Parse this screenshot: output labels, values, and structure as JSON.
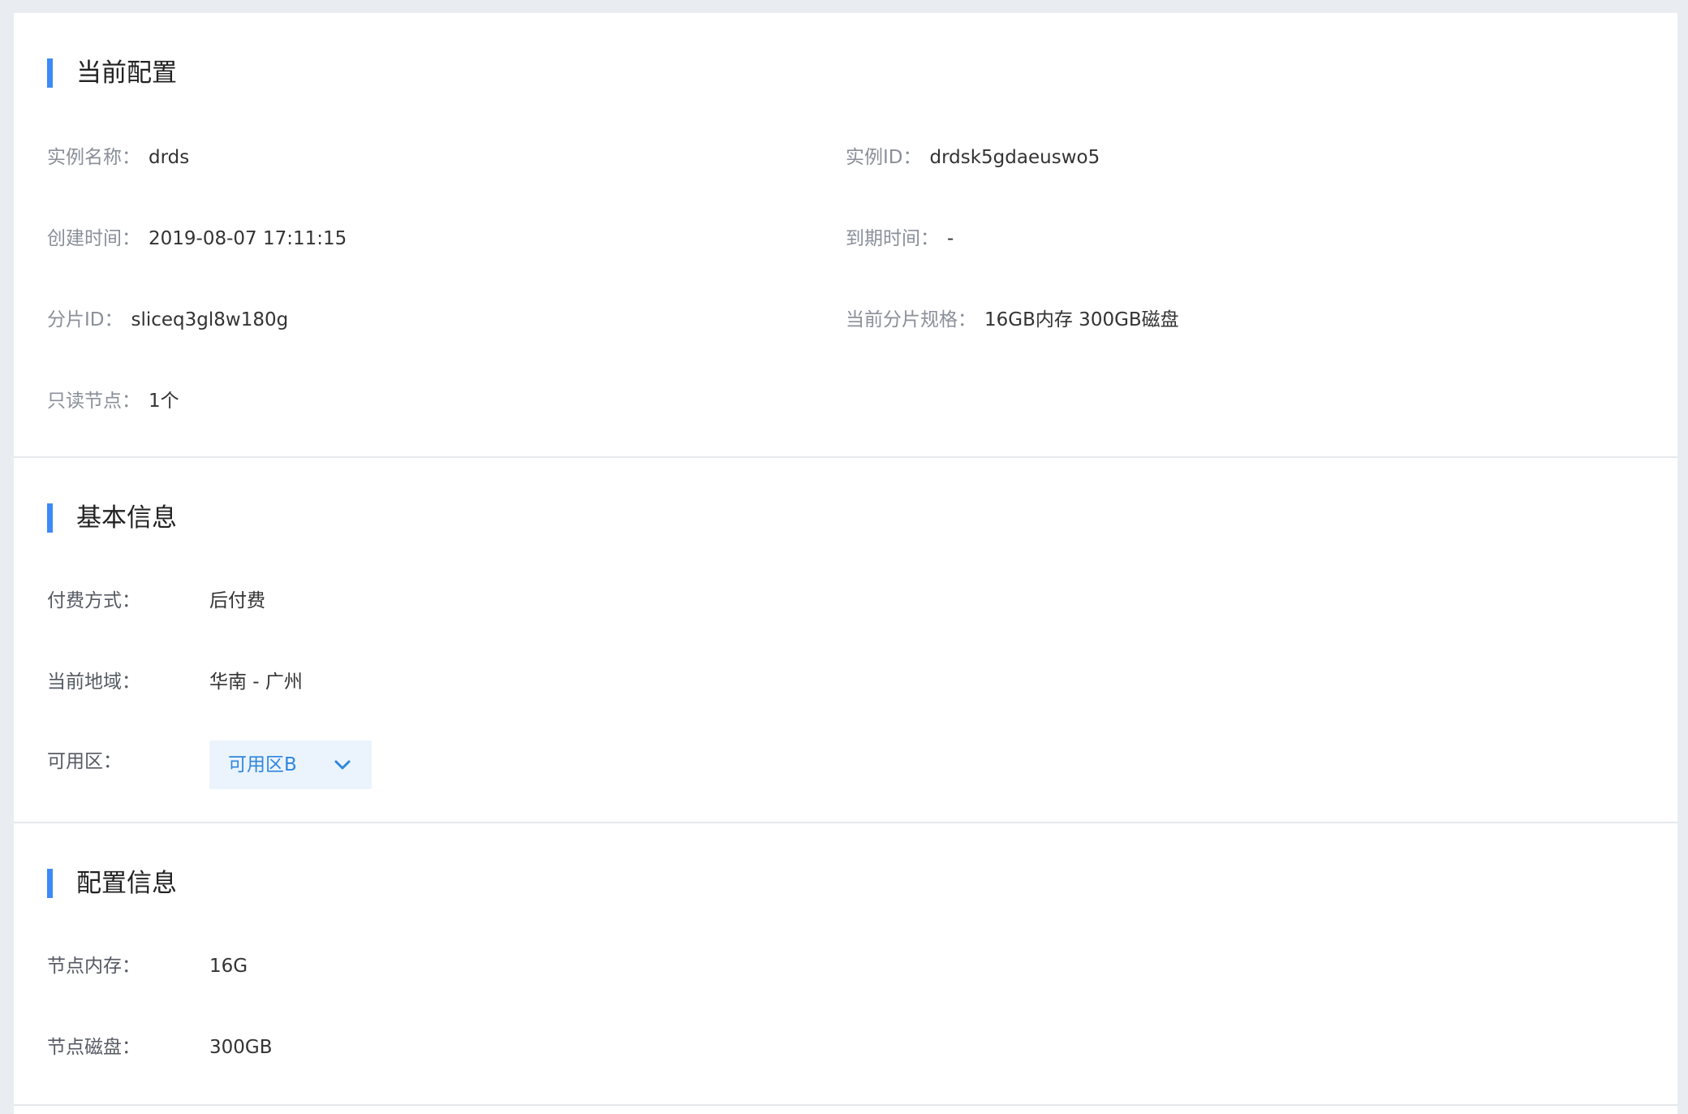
{
  "current_config": {
    "title": "当前配置",
    "instance_name_label": "实例名称：",
    "instance_name_value": "drds",
    "instance_id_label": "实例ID：",
    "instance_id_value": "drdsk5gdaeuswo5",
    "created_label": "创建时间：",
    "created_value": "2019-08-07 17:11:15",
    "expire_label": "到期时间：",
    "expire_value": "-",
    "shard_id_label": "分片ID：",
    "shard_id_value": "sliceq3gl8w180g",
    "shard_spec_label": "当前分片规格：",
    "shard_spec_value": "16GB内存 300GB磁盘",
    "readonly_label": "只读节点：",
    "readonly_value": "1个"
  },
  "basic_info": {
    "title": "基本信息",
    "billing_label": "付费方式：",
    "billing_value": "后付费",
    "region_label": "当前地域：",
    "region_value": "华南 - 广州",
    "zone_label": "可用区：",
    "zone_selected": "可用区B"
  },
  "config_info": {
    "title": "配置信息",
    "memory_label": "节点内存：",
    "memory_value": "16G",
    "disk_label": "节点磁盘：",
    "disk_value": "300GB"
  },
  "colors": {
    "accent": "#3d8af7",
    "dropdown_bg": "#ebf4fd",
    "dropdown_text": "#2f86e0",
    "page_bg": "#e9edf2"
  },
  "icons": {
    "zone_dropdown": "chevron-down-icon"
  }
}
